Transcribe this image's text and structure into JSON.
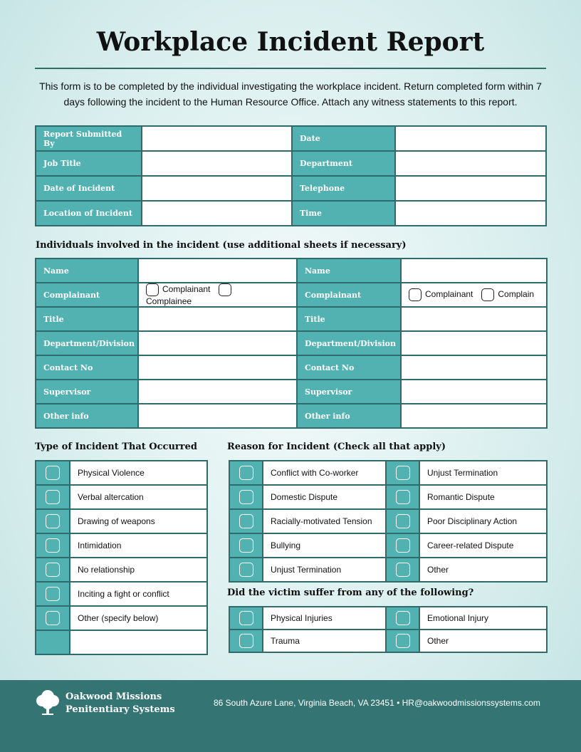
{
  "title": "Workplace Incident Report",
  "intro": "This form is to be completed by the individual investigating the workplace incident. Return completed form within 7 days following the incident to the  Human Resource Office. Attach any witness statements to this report.",
  "report_fields": [
    [
      "Report Submitted By",
      "Date"
    ],
    [
      "Job Title",
      "Department"
    ],
    [
      "Date of Incident",
      "Telephone"
    ],
    [
      "Location of Incident",
      "Time"
    ]
  ],
  "individuals": {
    "heading": "Individuals involved in the incident (use additional sheets if necessary)",
    "rows": [
      "Name",
      "Complainant",
      "Title",
      "Department/Division",
      "Contact No",
      "Supervisor",
      "Other info"
    ],
    "options_left": [
      "Complainant",
      "Complainee"
    ],
    "options_right": [
      "Complainant",
      "Complain"
    ]
  },
  "type": {
    "heading": "Type of Incident That Occurred",
    "items": [
      "Physical Violence",
      "Verbal altercation",
      "Drawing of weapons",
      "Intimidation",
      "No relationship",
      "Inciting a fight or conflict",
      "Other (specify below)",
      ""
    ]
  },
  "reason": {
    "heading": "Reason for Incident (Check all that apply)",
    "items": [
      [
        "Conflict with Co-worker",
        "Unjust Termination"
      ],
      [
        "Domestic Dispute",
        "Romantic Dispute"
      ],
      [
        "Racially-motivated Tension",
        "Poor Disciplinary Action"
      ],
      [
        "Bullying",
        "Career-related Dispute"
      ],
      [
        "Unjust Termination",
        "Other"
      ]
    ]
  },
  "victim": {
    "heading": "Did the victim suffer from any of the following?",
    "items": [
      [
        "Physical Injuries",
        "Emotional Injury"
      ],
      [
        "Trauma",
        "Other"
      ]
    ]
  },
  "footer": {
    "org_line1": "Oakwood Missions",
    "org_line2": "Penitentiary Systems",
    "address": "86 South Azure Lane, Virginia Beach, VA 23451  • HR@oakwoodmissionssystems.com"
  },
  "colors": {
    "teal": "#52b2b2",
    "border": "#2f6b6b",
    "footer": "#347573"
  }
}
